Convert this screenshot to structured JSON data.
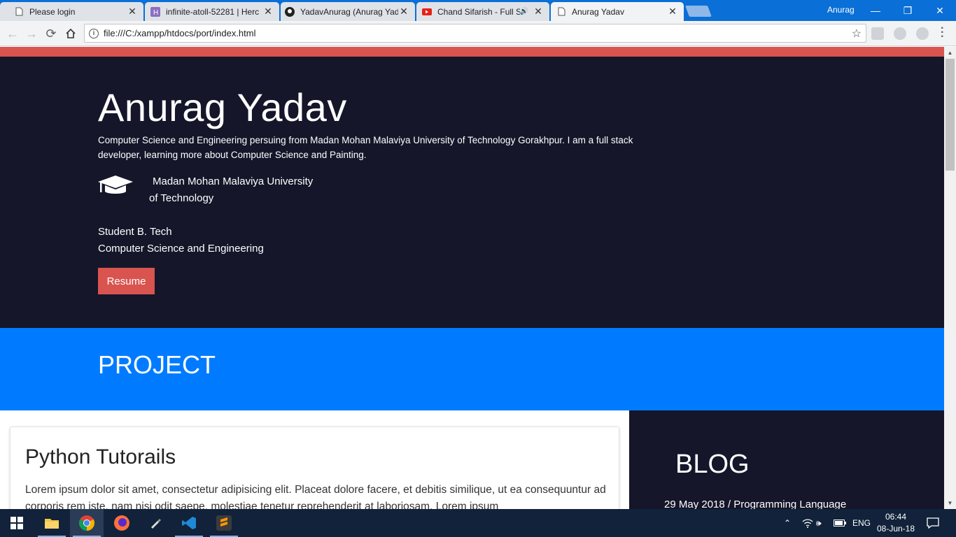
{
  "browser": {
    "tabs": [
      {
        "title": "Please login",
        "icon": "page-icon"
      },
      {
        "title": "infinite-atoll-52281 | Herc",
        "icon": "heroku-icon"
      },
      {
        "title": "YadavAnurag (Anurag Yad",
        "icon": "github-icon"
      },
      {
        "title": "Chand Sifarish - Full S",
        "icon": "youtube-icon",
        "audio": "🔊"
      },
      {
        "title": "Anurag Yadav",
        "icon": "page-icon"
      }
    ],
    "user": "Anurag",
    "address": "file:///C:/xampp/htdocs/port/index.html"
  },
  "hero": {
    "name": "Anurag Yadav",
    "bio": "Computer Science and Engineering persuing from Madan Mohan Malaviya University of Technology Gorakhpur. I am a full stack developer, learning more about Computer Science and Painting.",
    "university_line1": "Madan Mohan Malaviya University",
    "university_line2": "of Technology",
    "degree_line1": "Student B. Tech",
    "degree_line2": "Computer Science and Engineering",
    "resume_label": "Resume"
  },
  "project": {
    "heading": "PROJECT",
    "card_title": "Python Tutorails",
    "card_text": "Lorem ipsum dolor sit amet, consectetur adipisicing elit. Placeat dolore facere, et debitis similique, ut ea consequuntur ad corporis rem iste, nam nisi odit saepe, molestiae tenetur reprehenderit at laboriosam. Lorem ipsum"
  },
  "blog": {
    "heading": "BLOG",
    "post_meta": "29 May 2018 / Programming Language"
  },
  "taskbar": {
    "language": "ENG",
    "time": "06:44",
    "date": "08-Jun-18"
  },
  "colors": {
    "accent_red": "#d9534f",
    "hero_bg": "#15162a",
    "project_blue": "#007bff"
  }
}
